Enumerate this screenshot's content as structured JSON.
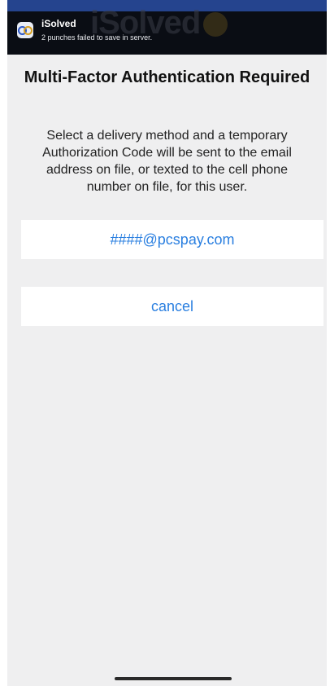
{
  "notification": {
    "app_name": "iSolved",
    "message": "2 punches failed to save in server.",
    "watermark": "iSolved",
    "app_icon": "isolved-go-icon"
  },
  "dialog": {
    "title": "Multi-Factor Authentication Required",
    "description": "Select a delivery method and a temporary Authorization Code will be sent to the email address on file, or texted to the cell phone number on file, for this user.",
    "email_option": "####@pcspay.com",
    "cancel_label": "cancel"
  },
  "colors": {
    "accent": "#2a7fe0",
    "background": "#efeff0",
    "banner": "#0a0d14"
  }
}
